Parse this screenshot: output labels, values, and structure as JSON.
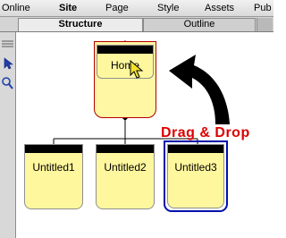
{
  "menu": {
    "items": [
      "Online",
      "Site",
      "Page",
      "Style",
      "Assets",
      "Pub"
    ],
    "active": "Site"
  },
  "tabs": [
    {
      "label": "Structure",
      "active": true
    },
    {
      "label": "Outline",
      "active": false
    }
  ],
  "gutter_icons": [
    "drag-handle-icon",
    "arrow-tool-icon",
    "zoom-tool-icon"
  ],
  "pages": {
    "home": "Home",
    "children": [
      "Untitled1",
      "Untitled2",
      "Untitled3"
    ],
    "selected": "Untitled3"
  },
  "annotation": {
    "text": "Drag & Drop",
    "color": "#dd0000"
  },
  "colors": {
    "page_fill": "#fff79e",
    "home_outline": "#b40000",
    "selection_outline": "#0011aa"
  }
}
